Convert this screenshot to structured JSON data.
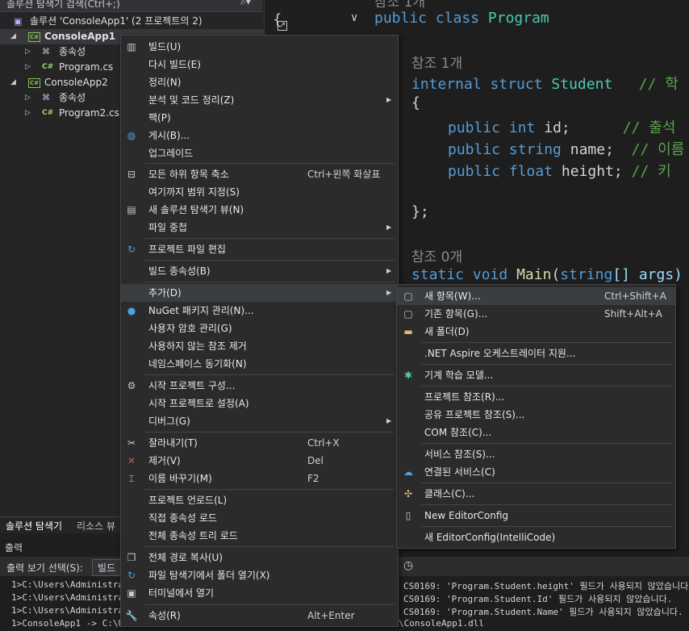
{
  "explorer": {
    "search_text": "솔루션 탐색기 검색(Ctrl+;)",
    "solution_label": "솔루션 'ConsoleApp1'  (2 프로젝트의 2)",
    "project1": "ConsoleApp1",
    "deps1": "종속성",
    "file1": "Program.cs",
    "project2": "ConsoleApp2",
    "deps2": "종속성",
    "file2": "Program2.cs",
    "cs_icon": "C#"
  },
  "editor": {
    "ref_top": "참조 1개",
    "line_class": [
      "public",
      "class",
      "Program"
    ],
    "ref1": "참조 1개",
    "struct_kw1": "internal",
    "struct_kw2": "struct",
    "struct_name": "Student",
    "struct_comment": "// 학",
    "brace_open": "{",
    "brace_close": "};",
    "f1_mod": "public",
    "f1_type": "int",
    "f1_name": "id;",
    "f1_comment": "// 출석",
    "f2_mod": "public",
    "f2_type": "string",
    "f2_name": "name;",
    "f2_comment": "// 이름",
    "f3_mod": "public",
    "f3_type": "float",
    "f3_name": "height;",
    "f3_comment": "// 키",
    "ref0": "참조 0개",
    "main_kw": "static",
    "main_type": "void",
    "main_name": "Main",
    "main_paren": "(",
    "main_argtype": "string",
    "main_args": "[] args)"
  },
  "tabs": {
    "solution_explorer": "솔루션 탐색기",
    "resource_view": "리소스 뷰"
  },
  "output": {
    "title": "출력",
    "show_label": "출력 보기 선택(S):",
    "show_value": "빌드",
    "lines_left": [
      "1>C:\\Users\\Administrato",
      "1>C:\\Users\\Administrato",
      "1>C:\\Users\\Administrato",
      "1>ConsoleApp1 -> C:\\Use"
    ],
    "lines_right": [
      "CS0169: 'Program.Student.height' 필드가 사용되지 않았습니다",
      "CS0169: 'Program.Student.Id' 필드가 사용되지 않았습니다.",
      "CS0169: 'Program.Student.Name' 필드가 사용되지 않았습니다.",
      "\\ConsoleApp1.dll"
    ]
  },
  "context_menu": {
    "items": [
      {
        "label": "빌드(U)",
        "shortcut": "",
        "icon": "build-icon"
      },
      {
        "label": "다시 빌드(E)",
        "shortcut": ""
      },
      {
        "label": "정리(N)",
        "shortcut": ""
      },
      {
        "label": "분석 및 코드 정리(Z)",
        "shortcut": "",
        "submenu": true
      },
      {
        "label": "팩(P)",
        "shortcut": ""
      },
      {
        "label": "게시(B)...",
        "shortcut": "",
        "icon": "globe-icon"
      },
      {
        "label": "업그레이드",
        "shortcut": ""
      },
      {
        "label": "모든 하위 항목 축소",
        "shortcut": "Ctrl+왼쪽 화살표",
        "icon": "collapse-icon"
      },
      {
        "label": "여기까지 범위 지정(S)",
        "shortcut": ""
      },
      {
        "label": "새 솔루션 탐색기 뷰(N)",
        "shortcut": "",
        "icon": "new-view-icon"
      },
      {
        "label": "파일 중첩",
        "shortcut": "",
        "submenu": true
      },
      {
        "label": "프로젝트 파일 편집",
        "shortcut": "",
        "icon": "edit-project-icon"
      },
      {
        "label": "빌드 종속성(B)",
        "shortcut": "",
        "submenu": true
      },
      {
        "label": "추가(D)",
        "shortcut": "",
        "submenu": true
      },
      {
        "label": "NuGet 패키지 관리(N)...",
        "shortcut": "",
        "icon": "nuget-icon"
      },
      {
        "label": "사용자 암호 관리(G)",
        "shortcut": ""
      },
      {
        "label": "사용하지 않는 참조 제거",
        "shortcut": ""
      },
      {
        "label": "네임스페이스 동기화(N)",
        "shortcut": ""
      },
      {
        "label": "시작 프로젝트 구성...",
        "shortcut": "",
        "icon": "gear-icon"
      },
      {
        "label": "시작 프로젝트로 설정(A)",
        "shortcut": ""
      },
      {
        "label": "디버그(G)",
        "shortcut": "",
        "submenu": true
      },
      {
        "label": "잘라내기(T)",
        "shortcut": "Ctrl+X",
        "icon": "scissors-icon"
      },
      {
        "label": "제거(V)",
        "shortcut": "Del",
        "icon": "remove-icon"
      },
      {
        "label": "이름 바꾸기(M)",
        "shortcut": "F2",
        "icon": "rename-icon"
      },
      {
        "label": "프로젝트 언로드(L)",
        "shortcut": ""
      },
      {
        "label": "직접 종속성 로드",
        "shortcut": ""
      },
      {
        "label": "전체 종속성 트리 로드",
        "shortcut": ""
      },
      {
        "label": "전체 경로 복사(U)",
        "shortcut": "",
        "icon": "copy-icon"
      },
      {
        "label": "파일 탐색기에서 폴더 열기(X)",
        "shortcut": "",
        "icon": "open-folder-icon"
      },
      {
        "label": "터미널에서 열기",
        "shortcut": "",
        "icon": "terminal-icon"
      },
      {
        "label": "속성(R)",
        "shortcut": "Alt+Enter",
        "icon": "wrench-icon"
      }
    ]
  },
  "add_submenu": {
    "items": [
      {
        "label": "새 항목(W)...",
        "shortcut": "Ctrl+Shift+A",
        "icon": "new-item-icon"
      },
      {
        "label": "기존 항목(G)...",
        "shortcut": "Shift+Alt+A",
        "icon": "existing-item-icon"
      },
      {
        "label": "새 폴더(D)",
        "shortcut": "",
        "icon": "new-folder-icon"
      },
      {
        "label": ".NET Aspire 오케스트레이터 지원...",
        "shortcut": ""
      },
      {
        "label": "기계 학습 모델...",
        "shortcut": "",
        "icon": "ml-model-icon"
      },
      {
        "label": "프로젝트 참조(R)...",
        "shortcut": ""
      },
      {
        "label": "공유 프로젝트 참조(S)...",
        "shortcut": ""
      },
      {
        "label": "COM 참조(C)...",
        "shortcut": ""
      },
      {
        "label": "서비스 참조(S)...",
        "shortcut": ""
      },
      {
        "label": "연결된 서비스(C)",
        "shortcut": "",
        "icon": "connected-service-icon"
      },
      {
        "label": "클래스(C)...",
        "shortcut": "",
        "icon": "class-icon"
      },
      {
        "label": "New EditorConfig",
        "shortcut": "",
        "icon": "editorconfig-icon"
      },
      {
        "label": "새 EditorConfig(IntelliCode)",
        "shortcut": ""
      }
    ]
  }
}
